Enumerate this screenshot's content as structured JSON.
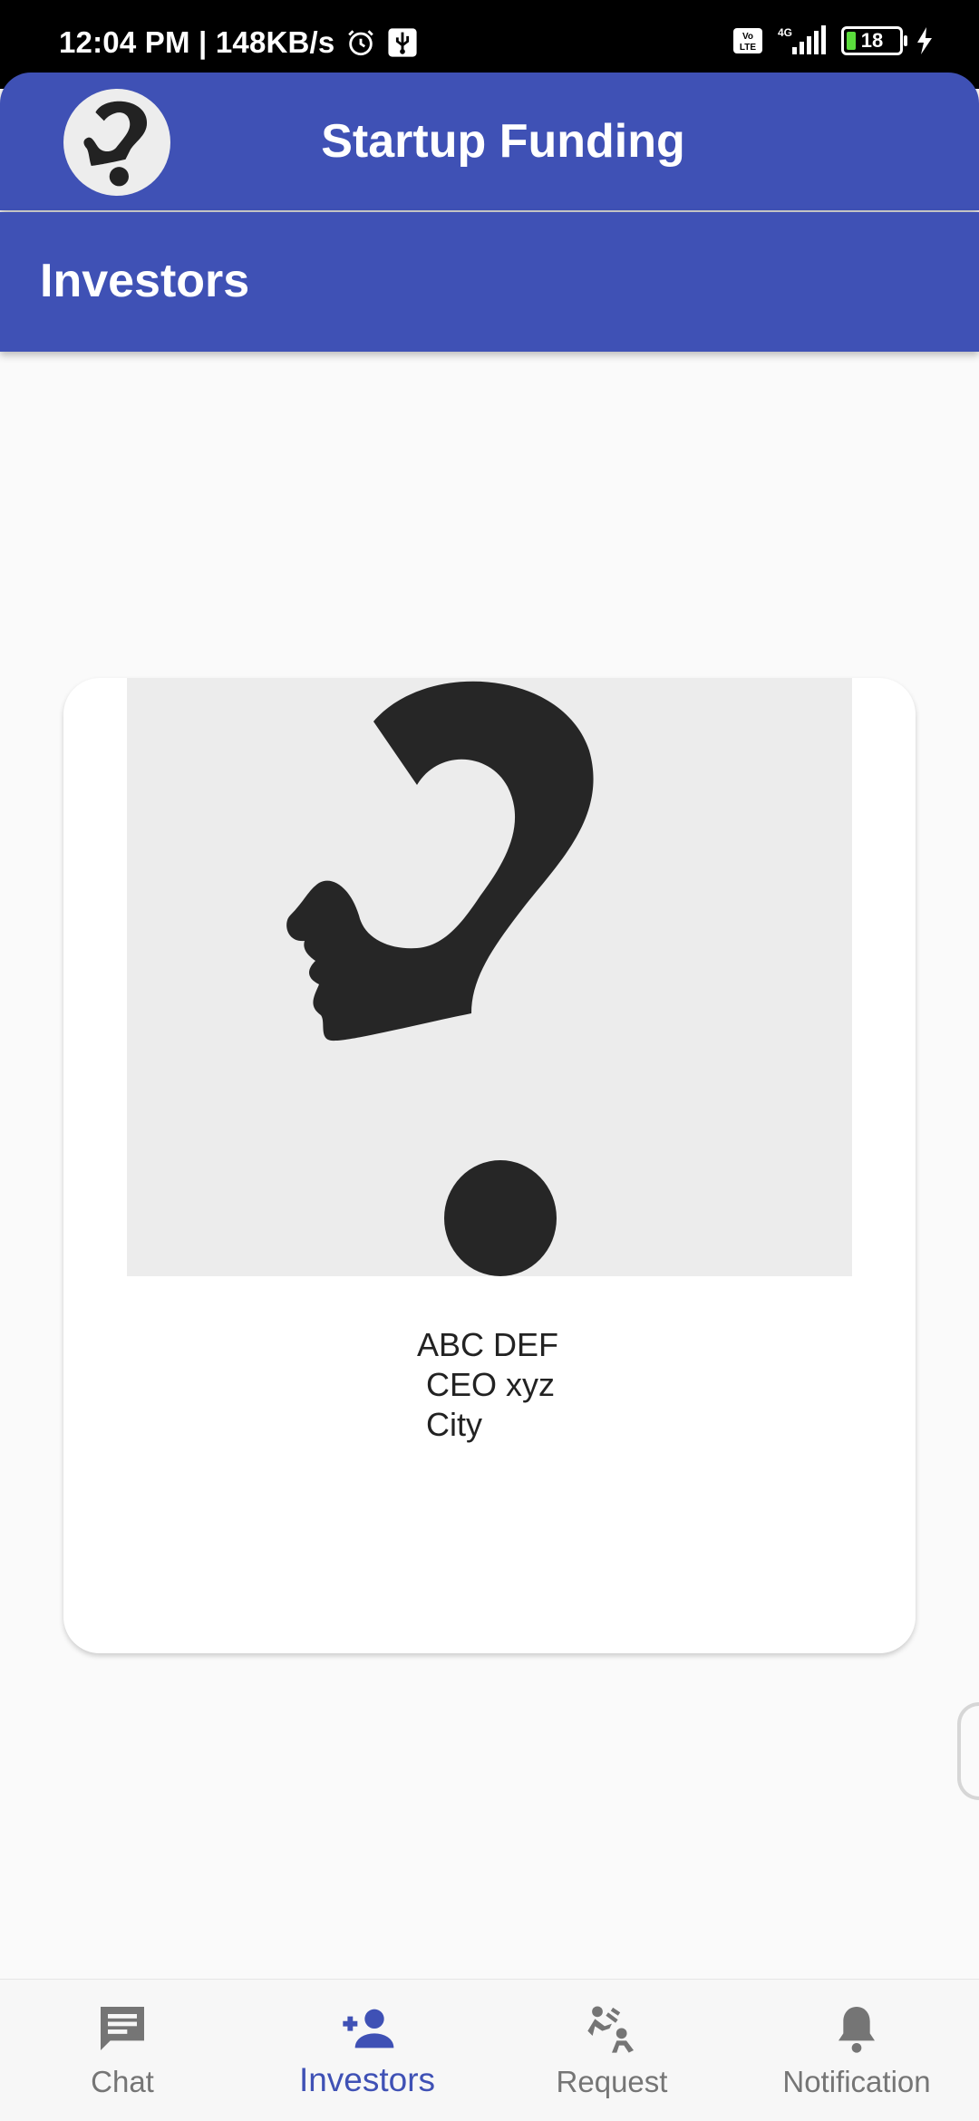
{
  "status_bar": {
    "time_speed": "12:04 PM | 148KB/s",
    "network_badge": "Vo LTE",
    "network_type": "4G",
    "battery_level": "18"
  },
  "app_bar": {
    "title": "Startup Funding",
    "logo_icon": "question-head-logo"
  },
  "sub_bar": {
    "title": "Investors"
  },
  "investor_card": {
    "image_icon": "question-head-image",
    "details": "ABC DEF\n CEO xyz\n City"
  },
  "bottom_nav": {
    "items": [
      {
        "label": "Chat",
        "icon": "chat-icon"
      },
      {
        "label": "Investors",
        "icon": "add-person-icon",
        "active": true
      },
      {
        "label": "Request",
        "icon": "request-icon"
      },
      {
        "label": "Notification",
        "icon": "bell-icon"
      }
    ]
  },
  "colors": {
    "primary": "#3f51b5",
    "background": "#fafafa",
    "inactive": "#757575"
  }
}
